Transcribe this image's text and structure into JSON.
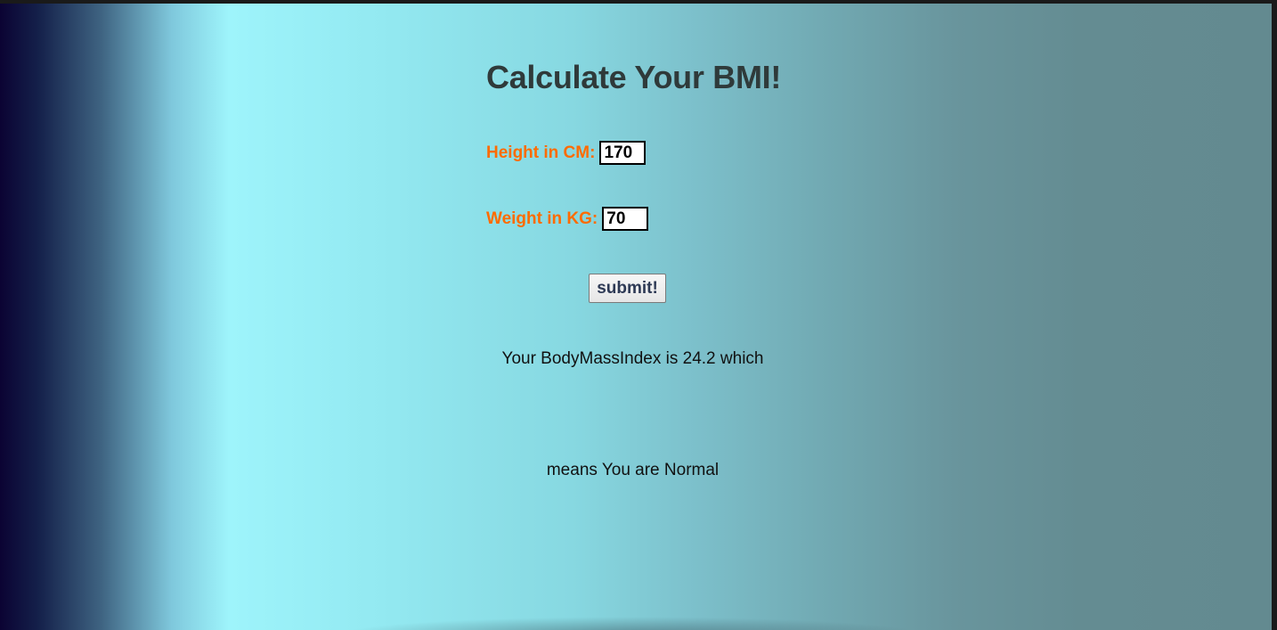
{
  "title": "Calculate Your BMI!",
  "form": {
    "height_label": "Height in CM:",
    "height_value": "170",
    "weight_label": "Weight in KG:",
    "weight_value": "70",
    "submit_label": "submit!"
  },
  "result": {
    "line1": "Your BodyMassIndex is 24.2 which",
    "line2": "means You are Normal"
  },
  "colors": {
    "label": "#ff6b00",
    "title": "#2f3a3a",
    "gradient_left": "#0b0333",
    "gradient_peak": "#9ef4fb",
    "gradient_right": "#638a90"
  }
}
